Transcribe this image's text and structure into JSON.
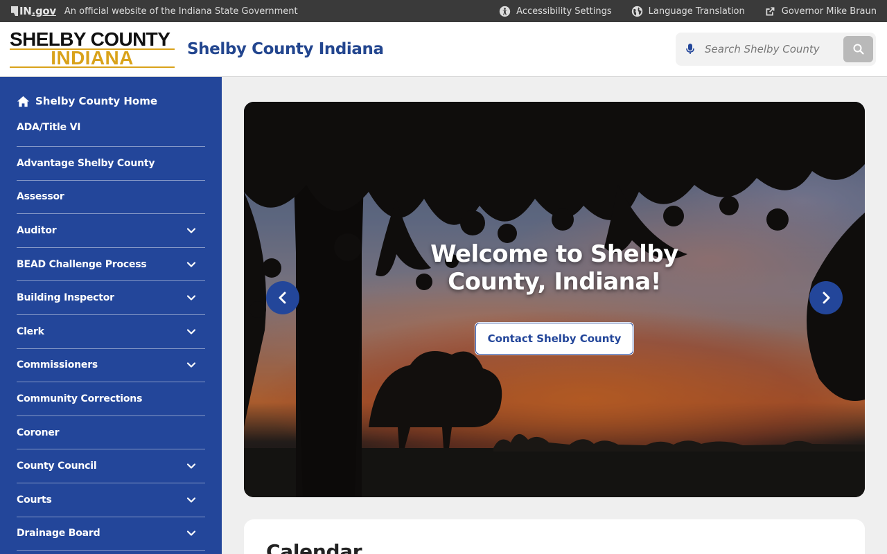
{
  "govbar": {
    "logo_text": "IN",
    "logo_suffix": ".gov",
    "official_text": "An official website of the Indiana State Government",
    "links": [
      {
        "label": "Accessibility Settings",
        "icon": "accessibility-icon"
      },
      {
        "label": "Language Translation",
        "icon": "globe-icon"
      },
      {
        "label": "Governor Mike Braun",
        "icon": "external-link-icon"
      }
    ]
  },
  "header": {
    "logo_line1": "SHELBY COUNTY",
    "logo_line2": "INDIANA",
    "site_title": "Shelby County Indiana",
    "search_placeholder": "Search Shelby County"
  },
  "sidebar": {
    "home_label": "Shelby County Home",
    "items": [
      {
        "label": "ADA/Title VI",
        "expandable": false
      },
      {
        "label": "Advantage Shelby County",
        "expandable": false
      },
      {
        "label": "Assessor",
        "expandable": false
      },
      {
        "label": "Auditor",
        "expandable": true
      },
      {
        "label": "BEAD Challenge Process",
        "expandable": true
      },
      {
        "label": "Building Inspector",
        "expandable": true
      },
      {
        "label": "Clerk",
        "expandable": true
      },
      {
        "label": "Commissioners",
        "expandable": true
      },
      {
        "label": "Community Corrections",
        "expandable": false
      },
      {
        "label": "Coroner",
        "expandable": false
      },
      {
        "label": "County Council",
        "expandable": true
      },
      {
        "label": "Courts",
        "expandable": true
      },
      {
        "label": "Drainage Board",
        "expandable": true
      }
    ]
  },
  "hero": {
    "title": "Welcome to Shelby County, Indiana!",
    "button_label": "Contact Shelby County"
  },
  "calendar": {
    "title": "Calendar"
  },
  "colors": {
    "brand_blue": "#23469a",
    "gov_bar": "#3a3a3a",
    "logo_gold": "#d9a21a"
  }
}
